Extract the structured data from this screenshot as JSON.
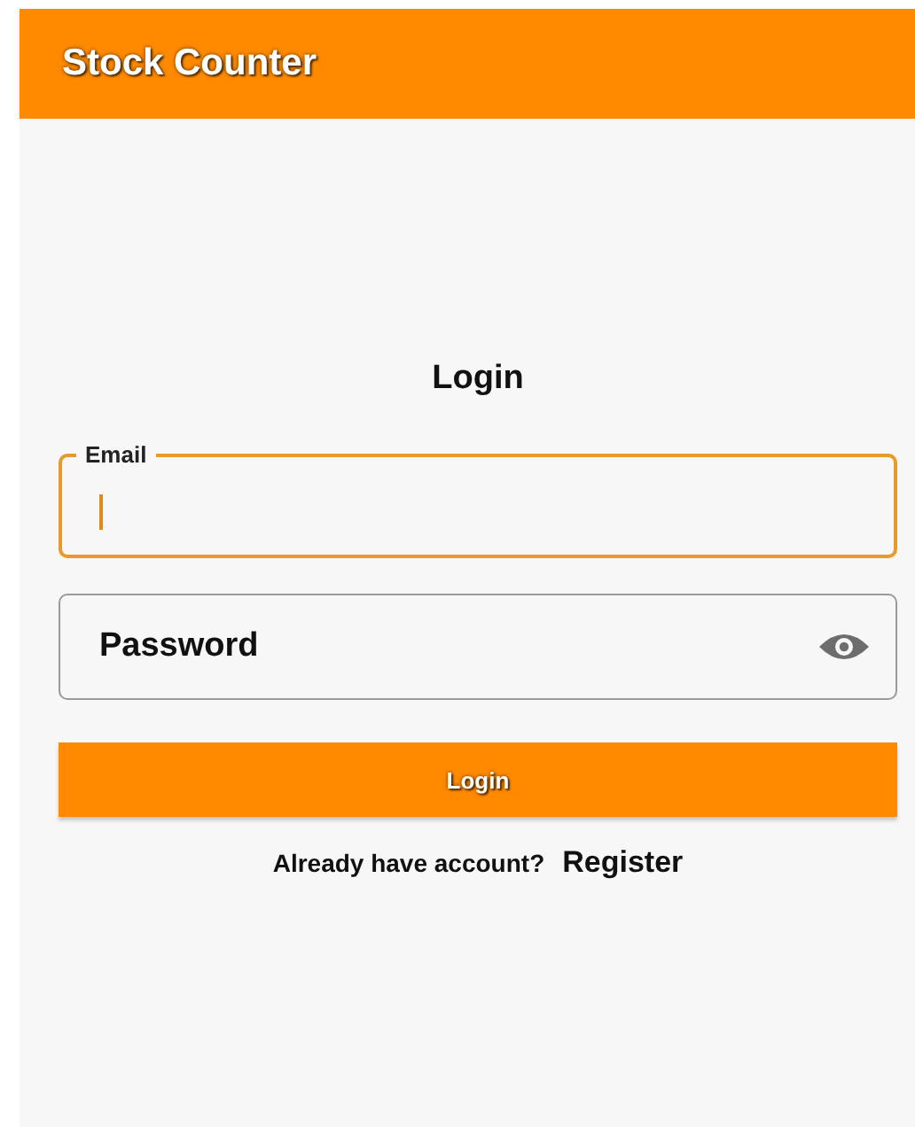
{
  "app_bar": {
    "title": "Stock Counter"
  },
  "form": {
    "heading": "Login",
    "fields": [
      {
        "kind": "text",
        "label": "Email",
        "focused": true
      },
      {
        "kind": "password",
        "placeholder": "Password",
        "focused": false
      }
    ],
    "submit": "Login",
    "footer": {
      "prompt": "Already have account?",
      "link": "Register"
    }
  }
}
